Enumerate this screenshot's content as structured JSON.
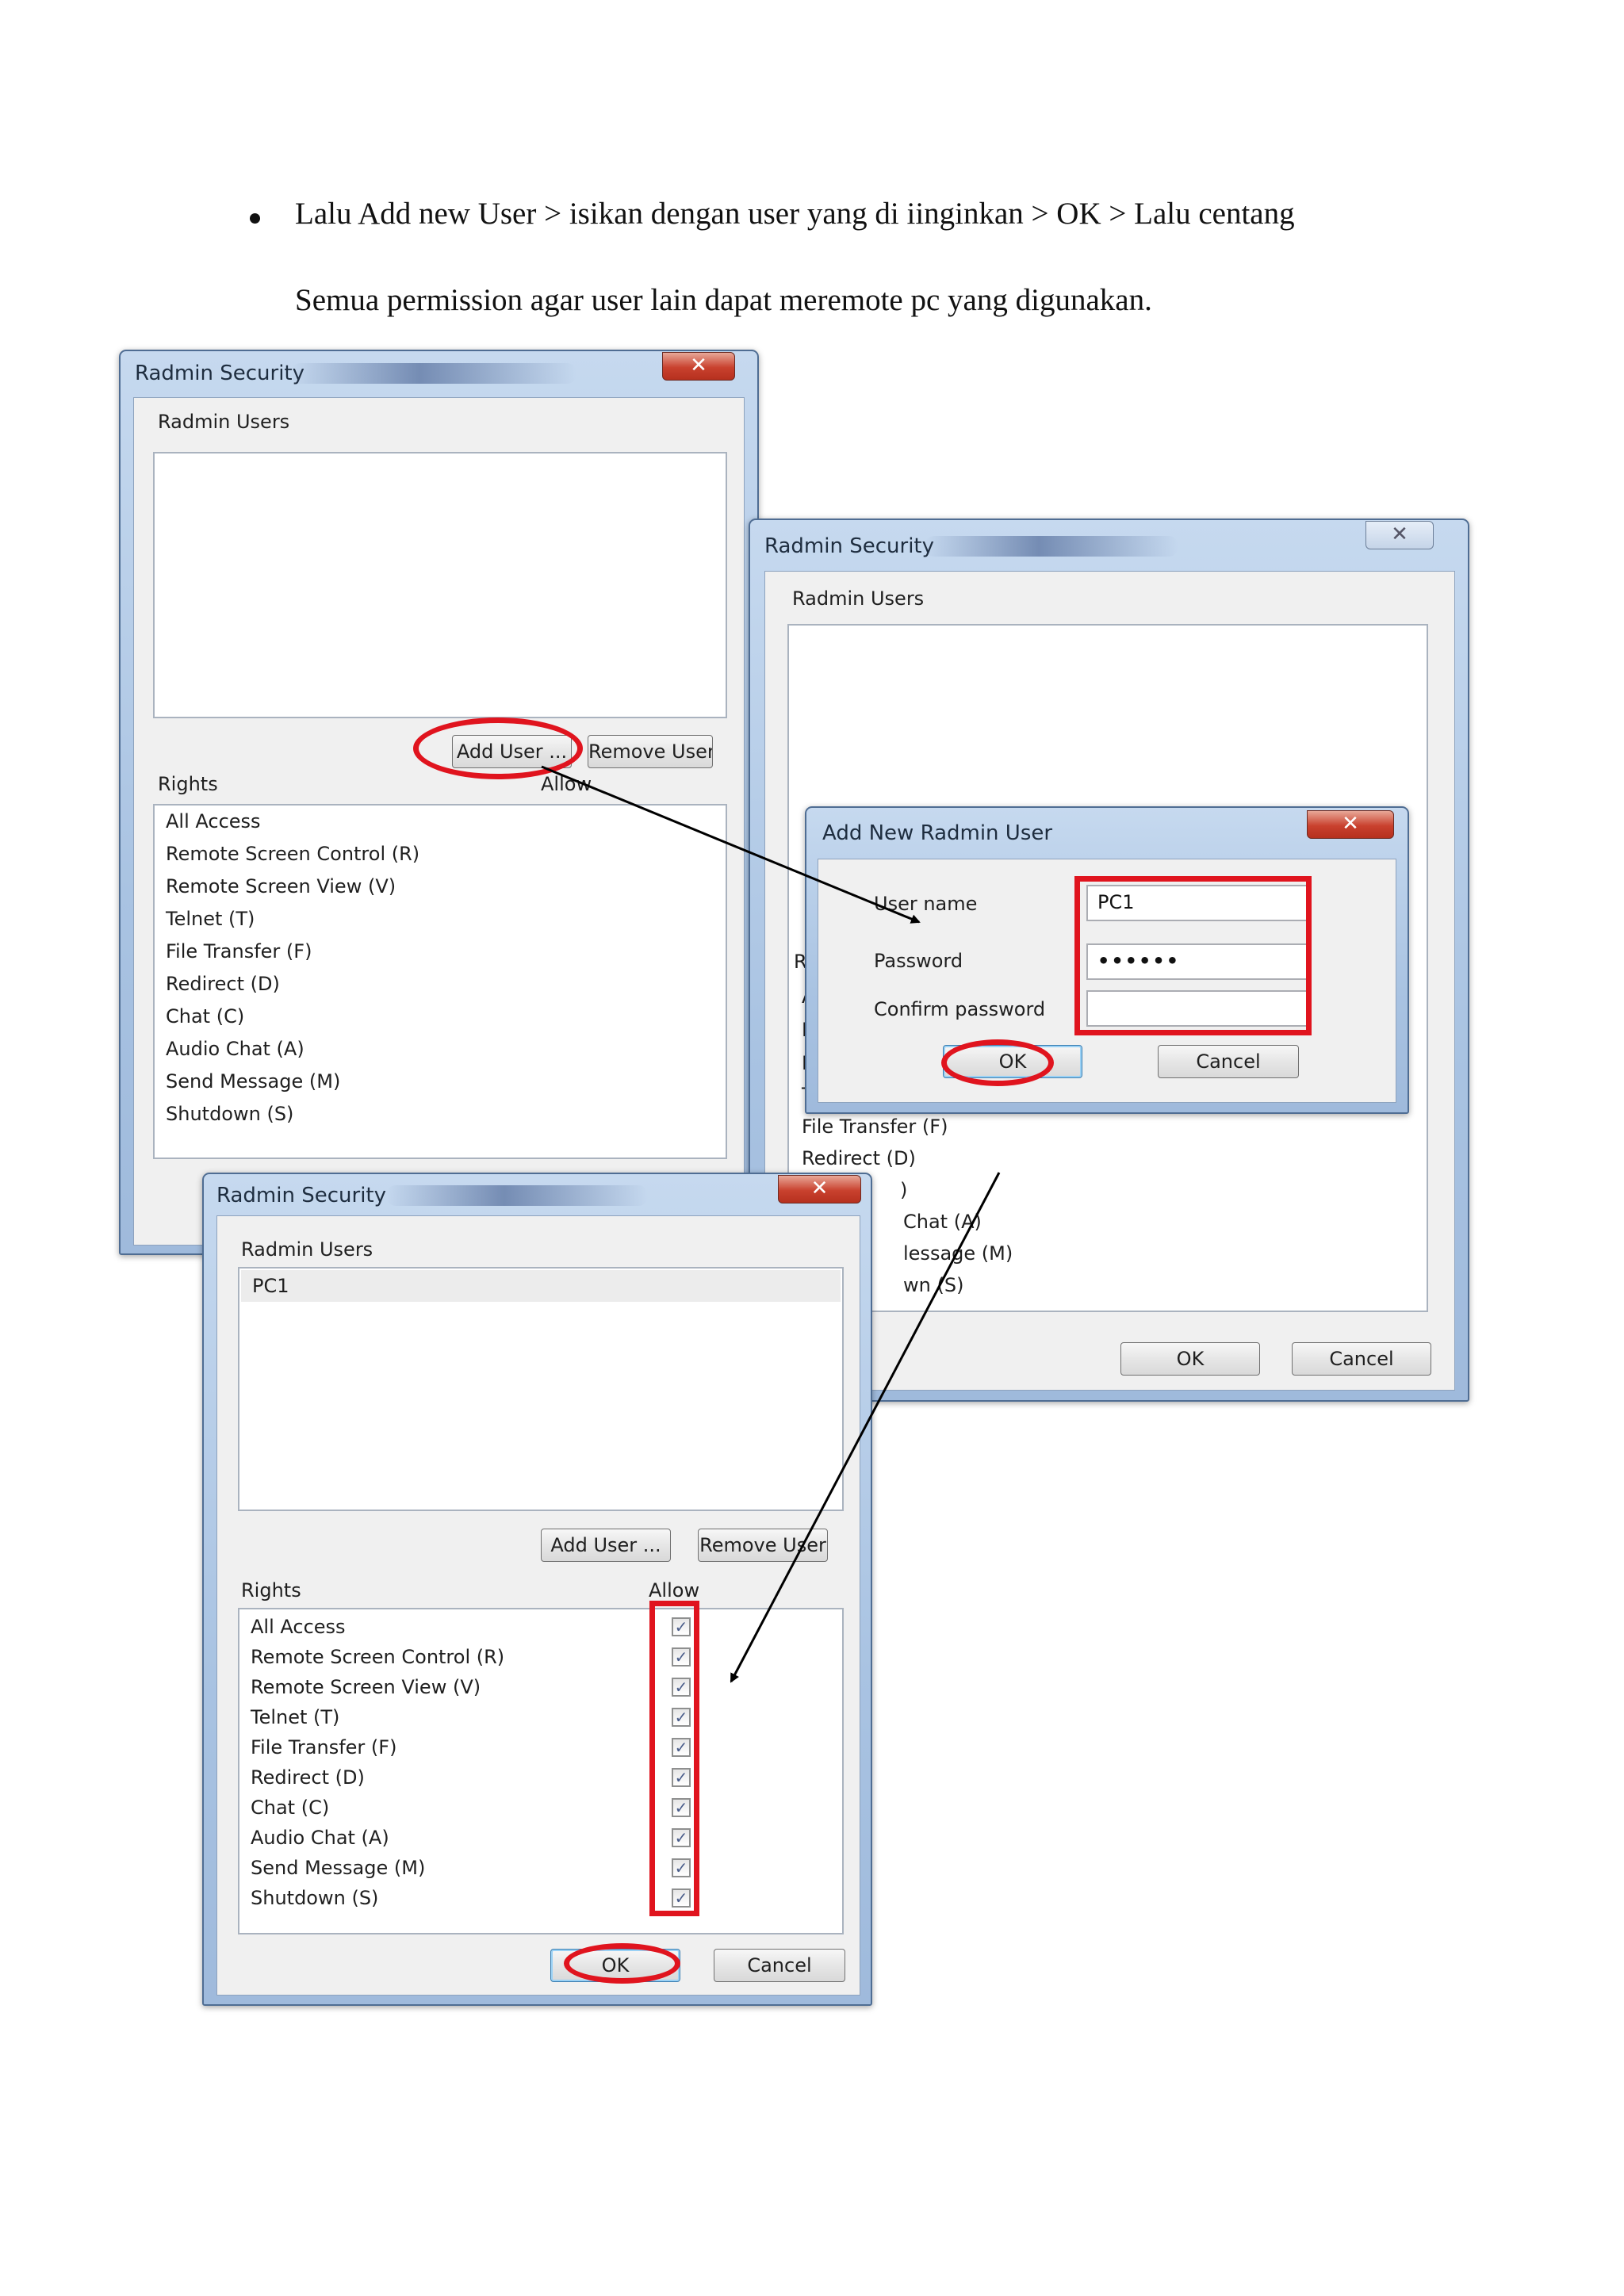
{
  "instructions": {
    "line1": "Lalu Add new User > isikan dengan user yang di iinginkan > OK > Lalu centang",
    "line2": "Semua permission agar user lain dapat meremote pc yang digunakan."
  },
  "window_a": {
    "title": "Radmin Security",
    "users_label": "Radmin Users",
    "add_user": "Add User ...",
    "remove_user": "Remove User",
    "rights_label": "Rights",
    "allow_label": "Allow",
    "rights": [
      "All Access",
      "Remote Screen Control (R)",
      "Remote Screen View (V)",
      "Telnet (T)",
      "File Transfer (F)",
      "Redirect (D)",
      "Chat (C)",
      "Audio Chat (A)",
      "Send Message (M)",
      "Shutdown (S)"
    ]
  },
  "window_b": {
    "title": "Radmin Security",
    "users_label": "Radmin Users",
    "rights_letter": "R",
    "partial_letters": [
      "A",
      "R",
      "R",
      "T"
    ],
    "visible_rights": [
      "File Transfer (F)",
      "Redirect (D)",
      ")",
      "Chat (A)",
      "lessage (M)",
      "wn (S)"
    ],
    "ok": "OK",
    "cancel": "Cancel"
  },
  "dialog": {
    "title": "Add New Radmin User",
    "username_label": "User name",
    "username_value": "PC1",
    "password_label": "Password",
    "password_value": "••••••",
    "confirm_label": "Confirm password",
    "confirm_value": "",
    "ok": "OK",
    "cancel": "Cancel"
  },
  "window_c": {
    "title": "Radmin Security",
    "users_label": "Radmin Users",
    "users": [
      "PC1"
    ],
    "add_user": "Add User ...",
    "remove_user": "Remove User",
    "rights_label": "Rights",
    "allow_label": "Allow",
    "rights": [
      "All Access",
      "Remote Screen Control (R)",
      "Remote Screen View (V)",
      "Telnet (T)",
      "File Transfer (F)",
      "Redirect (D)",
      "Chat (C)",
      "Audio Chat (A)",
      "Send Message (M)",
      "Shutdown (S)"
    ],
    "check_mark": "✓",
    "ok": "OK",
    "cancel": "Cancel"
  },
  "colors": {
    "annotation_red": "#e0141e",
    "title_bar_blue": "#a9c3e2"
  },
  "icons": {
    "close": "close-icon",
    "checkbox": "checkbox-checked-icon",
    "arrow": "arrow-icon"
  }
}
